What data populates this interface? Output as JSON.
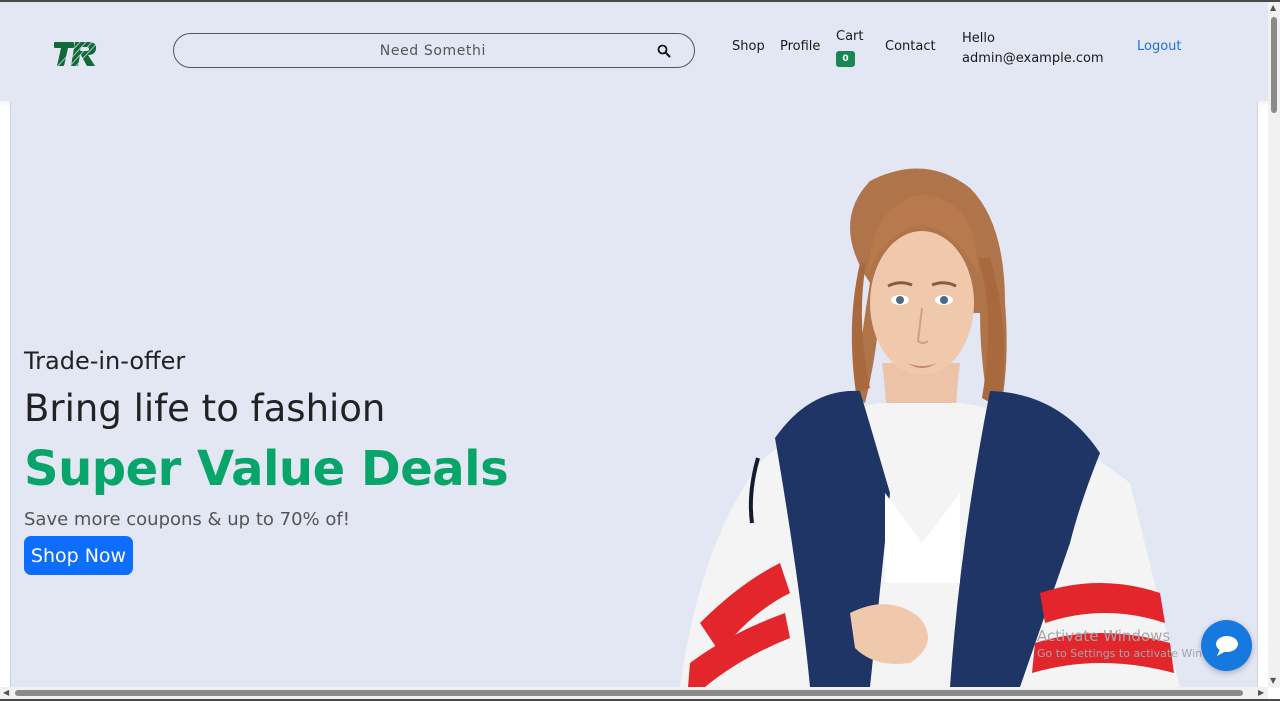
{
  "header": {
    "logo_text": "TR",
    "search": {
      "placeholder": "Need Somethi",
      "value": ""
    },
    "nav": {
      "shop": "Shop",
      "profile": "Profile",
      "cart": "Cart",
      "cart_count": "0",
      "contact": "Contact",
      "hello": "Hello",
      "user_email": "admin@example.com",
      "logout": "Logout"
    }
  },
  "hero": {
    "offer": "Trade-in-offer",
    "headline": "Bring life to fashion",
    "highlight": "Super Value Deals",
    "subtext": "Save more coupons & up to 70% of!",
    "cta": "Shop Now"
  },
  "overlay": {
    "watermark_title": "Activate Windows",
    "watermark_sub": "Go to Settings to activate Windows."
  },
  "colors": {
    "background": "#e3e6f3",
    "brand_green": "#08a56a",
    "primary_button": "#0d6efd",
    "badge": "#198754",
    "link": "#1d72d8",
    "chat": "#1679e0"
  },
  "icons": [
    "logo-icon",
    "search-icon",
    "chat-icon"
  ]
}
